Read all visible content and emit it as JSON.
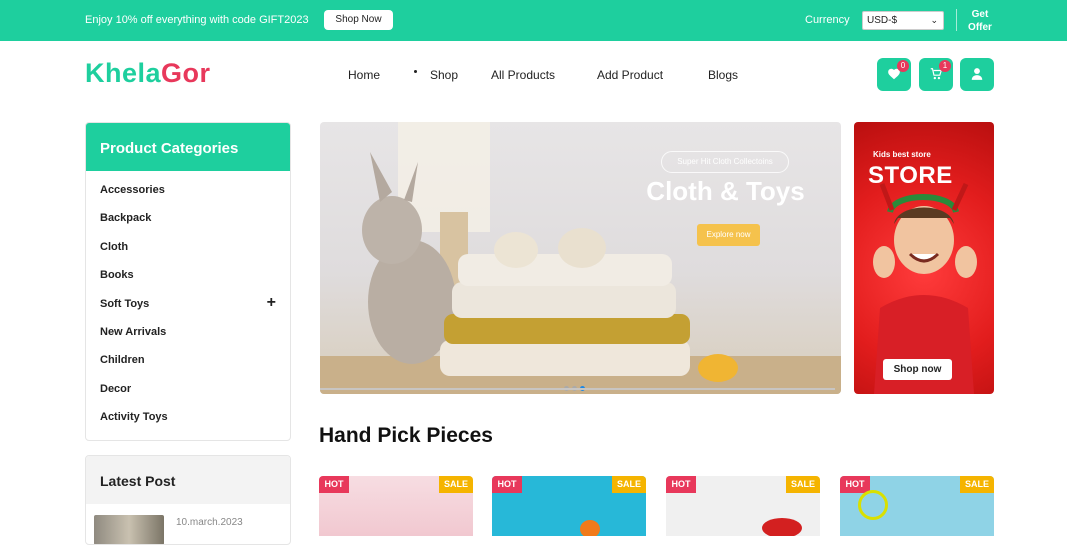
{
  "topbar": {
    "promo": "Enjoy 10% off everything with code GIFT2023",
    "shop_now": "Shop Now",
    "currency_label": "Currency",
    "currency_value": "USD-$",
    "get_offer_line1": "Get",
    "get_offer_line2": "Offer"
  },
  "brand": {
    "part1": "Khela",
    "part2": "Gor"
  },
  "nav": {
    "home": "Home",
    "shop": "Shop",
    "all_products": "All Products",
    "add_product": "Add Product",
    "blogs": "Blogs"
  },
  "icons": {
    "wishlist_count": "0",
    "cart_count": "1"
  },
  "categories": {
    "title": "Product Categories",
    "items": [
      "Accessories",
      "Backpack",
      "Cloth",
      "Books",
      "Soft Toys",
      "New Arrivals",
      "Children",
      "Decor",
      "Activity Toys"
    ],
    "expand_symbol": "+"
  },
  "latest_post": {
    "title": "Latest Post",
    "date": "10.march.2023"
  },
  "hero": {
    "tagline": "Super Hit Cloth Collectoins",
    "title": "Cloth & Toys",
    "button": "Explore now"
  },
  "side_banner": {
    "kicker": "Kids best store",
    "title": "STORE",
    "button": "Shop now"
  },
  "hand_pick": {
    "title": "Hand Pick Pieces",
    "cards": [
      {
        "hot": "HOT",
        "sale": "SALE"
      },
      {
        "hot": "HOT",
        "sale": "SALE"
      },
      {
        "hot": "HOT",
        "sale": "SALE"
      },
      {
        "hot": "HOT",
        "sale": "SALE"
      }
    ]
  },
  "colors": {
    "brand_green": "#1ecf9e",
    "brand_pink": "#e8385b",
    "sale_yellow": "#f5b400"
  }
}
